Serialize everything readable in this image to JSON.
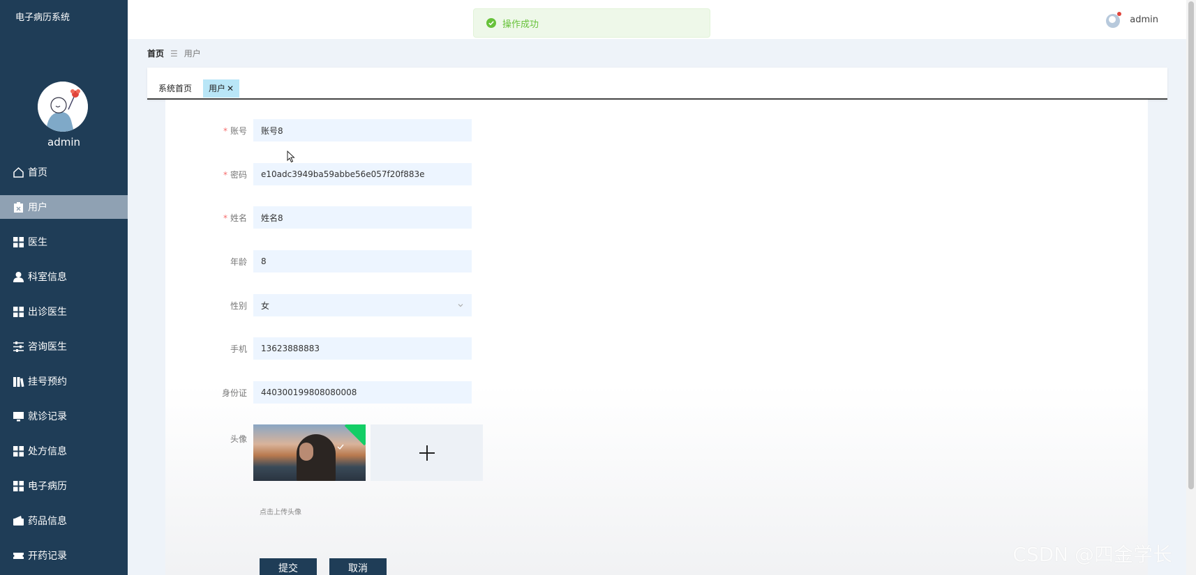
{
  "app": {
    "title": "电子病历系统"
  },
  "header": {
    "username": "admin"
  },
  "toast": {
    "message": "操作成功"
  },
  "sidebar": {
    "username": "admin",
    "items": [
      {
        "label": "首页",
        "icon": "home-icon"
      },
      {
        "label": "用户",
        "icon": "clipboard-icon",
        "active": true
      },
      {
        "label": "医生",
        "icon": "grid-icon"
      },
      {
        "label": "科室信息",
        "icon": "person-icon"
      },
      {
        "label": "出诊医生",
        "icon": "grid-icon"
      },
      {
        "label": "咨询医生",
        "icon": "sliders-icon"
      },
      {
        "label": "挂号预约",
        "icon": "books-icon"
      },
      {
        "label": "就诊记录",
        "icon": "monitor-icon"
      },
      {
        "label": "处方信息",
        "icon": "grid-icon"
      },
      {
        "label": "电子病历",
        "icon": "grid-icon"
      },
      {
        "label": "药品信息",
        "icon": "wallet-icon"
      },
      {
        "label": "开药记录",
        "icon": "ticket-icon"
      }
    ]
  },
  "breadcrumb": {
    "home": "首页",
    "separator": "☰",
    "current": "用户"
  },
  "tags": {
    "home": "系统首页",
    "active": "用户",
    "close": "✕"
  },
  "form": {
    "account": {
      "label": "账号",
      "value": "账号8"
    },
    "password": {
      "label": "密码",
      "value": "e10adc3949ba59abbe56e057f20f883e"
    },
    "name": {
      "label": "姓名",
      "value": "姓名8"
    },
    "age": {
      "label": "年龄",
      "value": "8"
    },
    "gender": {
      "label": "性别",
      "value": "女"
    },
    "phone": {
      "label": "手机",
      "value": "13623888883"
    },
    "idcard": {
      "label": "身份证",
      "value": "440300199808080008"
    },
    "avatar": {
      "label": "头像",
      "tip": "点击上传头像"
    },
    "submit": "提交",
    "cancel": "取消"
  },
  "watermark": "CSDN @四金学长",
  "colors": {
    "sidebar": "#1f3d57",
    "active_item": "#8fa1b3",
    "input_bg": "#edf5ff",
    "success": "#67c23a",
    "required": "#f56c6c",
    "tag_active": "#b9e6f7"
  }
}
